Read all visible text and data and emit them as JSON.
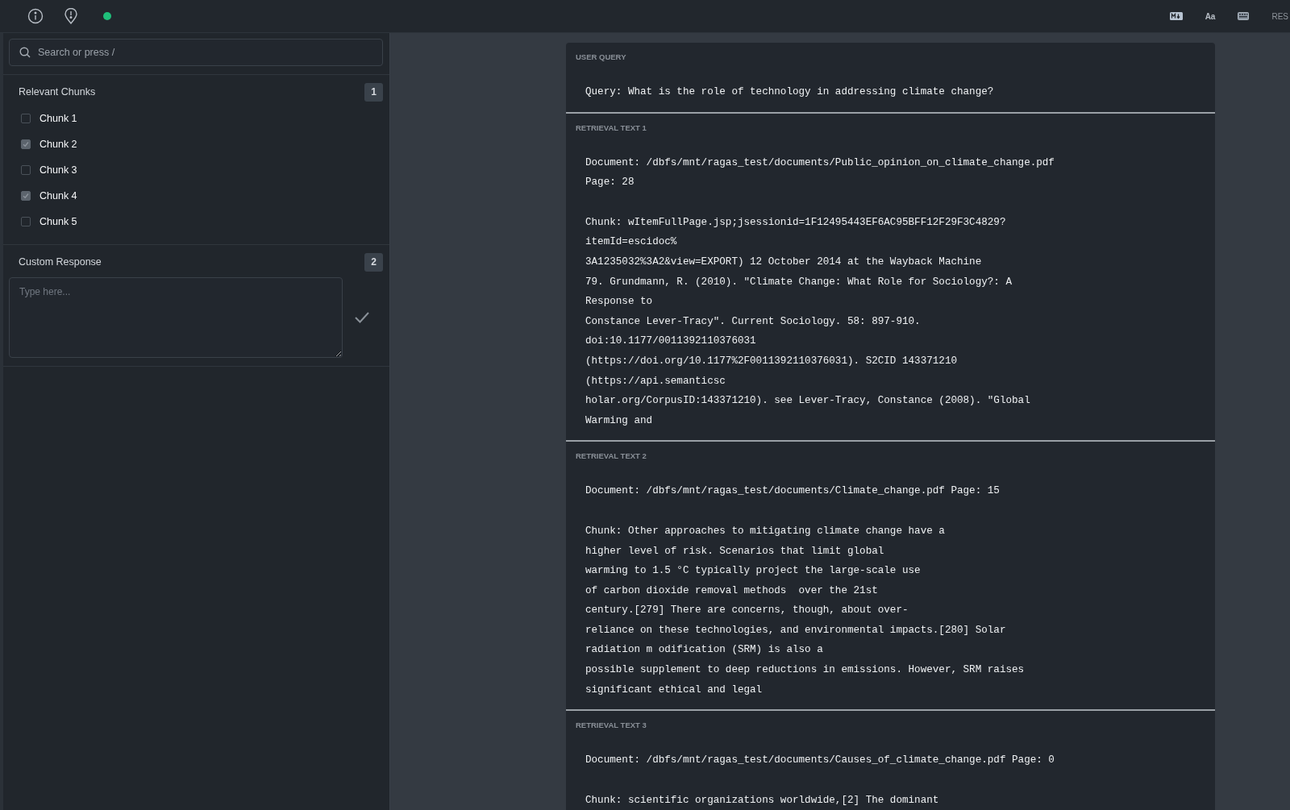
{
  "toolbar": {
    "status_online": true,
    "right_texts": [
      "Aa",
      "RES"
    ]
  },
  "sidebar": {
    "search": {
      "placeholder": "Search or press /"
    },
    "sections": [
      {
        "kind": "checklist",
        "title": "Relevant Chunks",
        "badge": "1",
        "items": [
          {
            "label": "Chunk 1",
            "checked": false
          },
          {
            "label": "Chunk 2",
            "checked": true
          },
          {
            "label": "Chunk 3",
            "checked": false
          },
          {
            "label": "Chunk 4",
            "checked": true
          },
          {
            "label": "Chunk 5",
            "checked": false
          }
        ]
      },
      {
        "kind": "response",
        "title": "Custom Response",
        "badge": "2",
        "placeholder": "Type here..."
      }
    ]
  },
  "cards": [
    {
      "label": "USER QUERY",
      "paragraphs": [
        [
          "Query: What is the role of technology in addressing climate change?"
        ]
      ]
    },
    {
      "label": "RETRIEVAL TEXT 1",
      "paragraphs": [
        [
          "Document: /dbfs/mnt/ragas_test/documents/Public_opinion_on_climate_change.pdf",
          "Page: 28"
        ],
        [
          "Chunk: wItemFullPage.jsp;jsessionid=1F12495443EF6AC95BFF12F29F3C4829?",
          "itemId=escidoc%",
          "3A1235032%3A2&view=EXPORT) 12 October 2014 at the Wayback Machine",
          "79. Grundmann, R. (2010). \"Climate Change: What Role for Sociology?: A",
          "Response to",
          "Constance Lever-Tracy\". Current Sociology. 58: 897-910.",
          "doi:10.1177/0011392110376031",
          "(https://doi.org/10.1177%2F0011392110376031). S2CID 143371210",
          "(https://api.semanticsc",
          "holar.org/CorpusID:143371210). see Lever-Tracy, Constance (2008). \"Global",
          "Warming and"
        ]
      ]
    },
    {
      "label": "RETRIEVAL TEXT 2",
      "paragraphs": [
        [
          "Document: /dbfs/mnt/ragas_test/documents/Climate_change.pdf Page: 15"
        ],
        [
          "Chunk: Other approaches to mitigating climate change have a",
          "higher level of risk. Scenarios that limit global",
          "warming to 1.5 °C typically project the large-scale use",
          "of carbon dioxide removal methods  over the 21st",
          "century.[279] There are concerns, though, about over-",
          "reliance on these technologies, and environmental impacts.[280] Solar",
          "radiation m odification (SRM) is also a",
          "possible supplement to deep reductions in emissions. However, SRM raises",
          "significant ethical and legal"
        ]
      ]
    },
    {
      "label": "RETRIEVAL TEXT 3",
      "paragraphs": [
        [
          "Document: /dbfs/mnt/ragas_test/documents/Causes_of_climate_change.pdf Page: 0"
        ],
        [
          "Chunk: scientific organizations worldwide,[2] The dominant"
        ]
      ]
    }
  ]
}
